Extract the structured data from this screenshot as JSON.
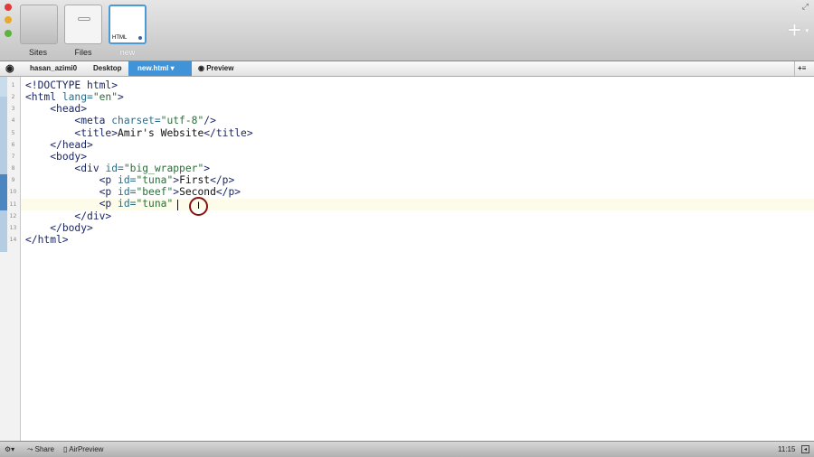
{
  "toolbar": {
    "tiles": [
      {
        "label": "Sites"
      },
      {
        "label": "Files"
      },
      {
        "label": "new",
        "badge": "HTML"
      }
    ],
    "add_icon": "plus-icon"
  },
  "breadcrumb": {
    "items": [
      "hasan_azimi0",
      "Desktop",
      "new.html",
      "Preview"
    ]
  },
  "editor": {
    "current_line": 11,
    "lines": [
      [
        [
          "t-tag",
          "<!DOCTYPE html>"
        ]
      ],
      [
        [
          "t-tag",
          "<html "
        ],
        [
          "t-attr",
          "lang="
        ],
        [
          "t-str",
          "\"en\""
        ],
        [
          "t-tag",
          ">"
        ]
      ],
      [
        [
          "t-text",
          "    "
        ],
        [
          "t-tag",
          "<head>"
        ]
      ],
      [
        [
          "t-text",
          "        "
        ],
        [
          "t-tag",
          "<meta "
        ],
        [
          "t-attr",
          "charset="
        ],
        [
          "t-str",
          "\"utf-8\""
        ],
        [
          "t-tag",
          "/>"
        ]
      ],
      [
        [
          "t-text",
          "        "
        ],
        [
          "t-tag",
          "<title>"
        ],
        [
          "t-text",
          "Amir's Website"
        ],
        [
          "t-tag",
          "</title>"
        ]
      ],
      [
        [
          "t-text",
          "    "
        ],
        [
          "t-tag",
          "</head>"
        ]
      ],
      [
        [
          "t-text",
          "    "
        ],
        [
          "t-tag",
          "<body>"
        ]
      ],
      [
        [
          "t-text",
          "        "
        ],
        [
          "t-tag",
          "<div "
        ],
        [
          "t-attr",
          "id="
        ],
        [
          "t-str",
          "\"big_wrapper\""
        ],
        [
          "t-tag",
          ">"
        ]
      ],
      [
        [
          "t-text",
          "            "
        ],
        [
          "t-tag",
          "<p "
        ],
        [
          "t-attr",
          "id="
        ],
        [
          "t-str",
          "\"tuna\""
        ],
        [
          "t-tag",
          ">"
        ],
        [
          "t-text",
          "First"
        ],
        [
          "t-tag",
          "</p>"
        ]
      ],
      [
        [
          "t-text",
          "            "
        ],
        [
          "t-tag",
          "<p "
        ],
        [
          "t-attr",
          "id="
        ],
        [
          "t-str",
          "\"beef\""
        ],
        [
          "t-tag",
          ">"
        ],
        [
          "t-text",
          "Second"
        ],
        [
          "t-tag",
          "</p>"
        ]
      ],
      [
        [
          "t-text",
          "            "
        ],
        [
          "t-tag",
          "<p "
        ],
        [
          "t-attr",
          "id="
        ],
        [
          "t-str",
          "\"tuna\""
        ]
      ],
      [
        [
          "t-text",
          "        "
        ],
        [
          "t-tag",
          "</div>"
        ]
      ],
      [
        [
          "t-text",
          "    "
        ],
        [
          "t-tag",
          "</body>"
        ]
      ],
      [
        [
          "t-tag",
          "</html>"
        ]
      ]
    ]
  },
  "status": {
    "share": "Share",
    "airpreview": "AirPreview",
    "cursor_pos": "11:15"
  }
}
